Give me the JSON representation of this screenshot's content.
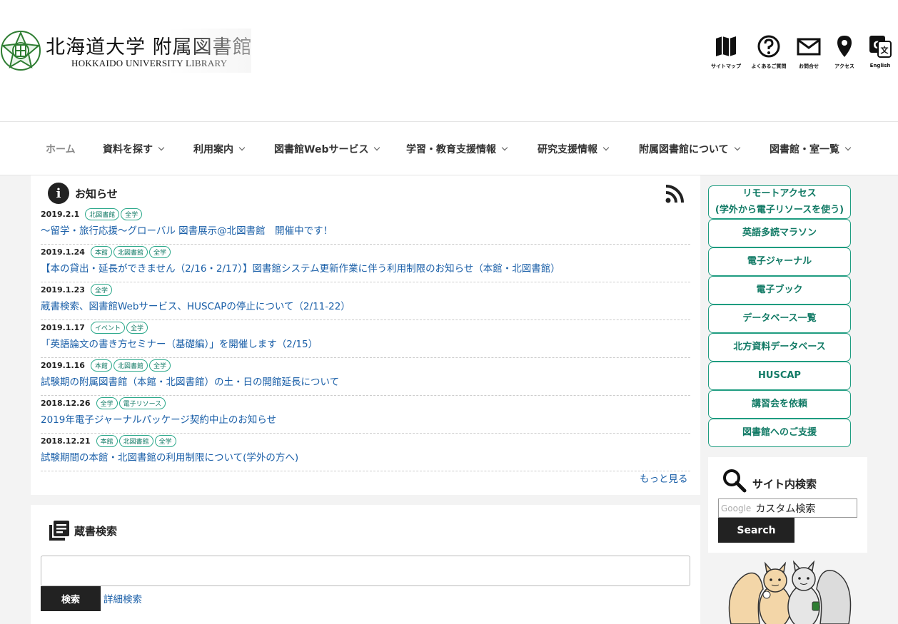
{
  "header": {
    "logo_ja": "北海道大学 附属図書館",
    "logo_en": "HOKKAIDO UNIVERSITY LIBRARY",
    "utility": [
      {
        "label": "サイトマップ",
        "icon": "map-icon"
      },
      {
        "label": "よくあるご質問",
        "icon": "question-icon"
      },
      {
        "label": "お問合せ",
        "icon": "mail-icon"
      },
      {
        "label": "アクセス",
        "icon": "location-pin-icon"
      },
      {
        "label": "English",
        "icon": "translate-icon"
      }
    ]
  },
  "nav": {
    "items": [
      {
        "label": "ホーム"
      },
      {
        "label": "資料を探す"
      },
      {
        "label": "利用案内"
      },
      {
        "label": "図書館Webサービス"
      },
      {
        "label": "学習・教育支援情報"
      },
      {
        "label": "研究支援情報"
      },
      {
        "label": "附属図書館について"
      },
      {
        "label": "図書館・室一覧"
      }
    ]
  },
  "news": {
    "title": "お知らせ",
    "more": "もっと見る",
    "items": [
      {
        "date": "2019.2.1",
        "tags": [
          "北図書館",
          "全学"
        ],
        "title": "〜留学・旅行応援〜グローバル 図書展示@北図書館　開催中です！"
      },
      {
        "date": "2019.1.24",
        "tags": [
          "本館",
          "北図書館",
          "全学"
        ],
        "title": "【本の貸出・延長ができません（2/16・2/17）】図書館システム更新作業に伴う利用制限のお知らせ（本館・北図書館）"
      },
      {
        "date": "2019.1.23",
        "tags": [
          "全学"
        ],
        "title": "蔵書検索、図書館Webサービス、HUSCAPの停止について（2/11-22）"
      },
      {
        "date": "2019.1.17",
        "tags": [
          "イベント",
          "全学"
        ],
        "title": "「英語論文の書き方セミナー（基礎編）」を開催します（2/15）"
      },
      {
        "date": "2019.1.16",
        "tags": [
          "本館",
          "北図書館",
          "全学"
        ],
        "title": "試験期の附属図書館（本館・北図書館）の土・日の開館延長について"
      },
      {
        "date": "2018.12.26",
        "tags": [
          "全学",
          "電子リソース"
        ],
        "title": "2019年電子ジャーナルパッケージ契約中止のお知らせ"
      },
      {
        "date": "2018.12.21",
        "tags": [
          "本館",
          "北図書館",
          "全学"
        ],
        "title": "試験期間の本館・北図書館の利用制限について(学外の方へ)"
      }
    ]
  },
  "catalog": {
    "title": "蔵書検索",
    "search_button": "検索",
    "advanced": "詳細検索"
  },
  "sidebar": {
    "links": [
      {
        "line1": "リモートアクセス",
        "line2": "(学外から電子リソースを使う)"
      },
      {
        "line1": "英語多読マラソン"
      },
      {
        "line1": "電子ジャーナル"
      },
      {
        "line1": "電子ブック"
      },
      {
        "line1": "データベース一覧"
      },
      {
        "line1": "北方資料データベース"
      },
      {
        "line1": "HUSCAP"
      },
      {
        "line1": "講習会を依頼"
      },
      {
        "line1": "図書館へのご支援"
      }
    ],
    "site_search": {
      "title": "サイト内検索",
      "google": "Google",
      "placeholder": "カスタム検索",
      "button": "Search"
    }
  }
}
